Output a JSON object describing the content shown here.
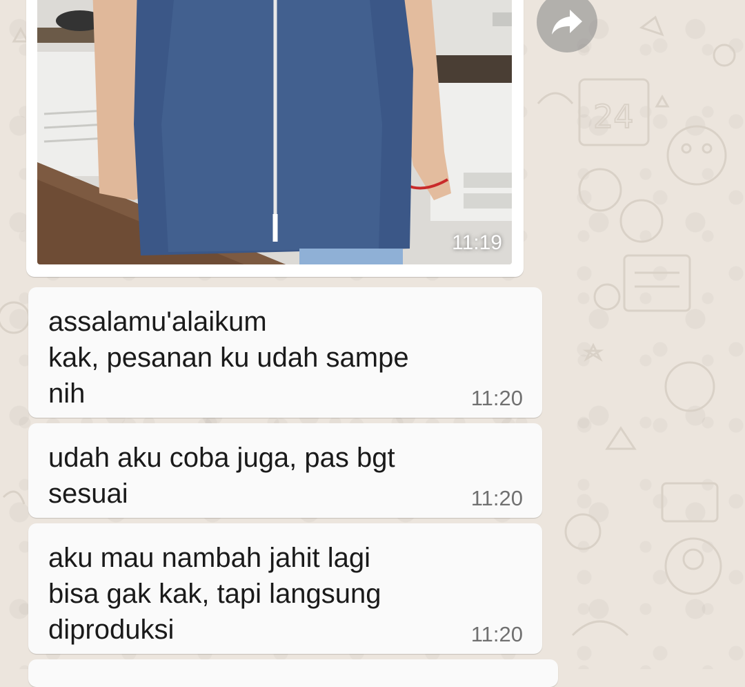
{
  "chat": {
    "image_message": {
      "time": "11:19"
    },
    "messages": [
      {
        "lines": [
          "assalamu'alaikum",
          "kak, pesanan ku udah sampe",
          "nih"
        ],
        "time": "11:20"
      },
      {
        "lines": [
          "udah aku coba juga, pas bgt",
          "sesuai"
        ],
        "time": "11:20"
      },
      {
        "lines": [
          "aku mau nambah jahit lagi",
          "bisa gak kak, tapi langsung",
          "diproduksi"
        ],
        "time": "11:20"
      }
    ]
  },
  "icons": {
    "forward": "forward-arrow-icon"
  },
  "colors": {
    "wallpaper": "#ece5dd",
    "bubble": "#fafafa",
    "timestamp": "#707070",
    "text": "#1a1a1a"
  }
}
